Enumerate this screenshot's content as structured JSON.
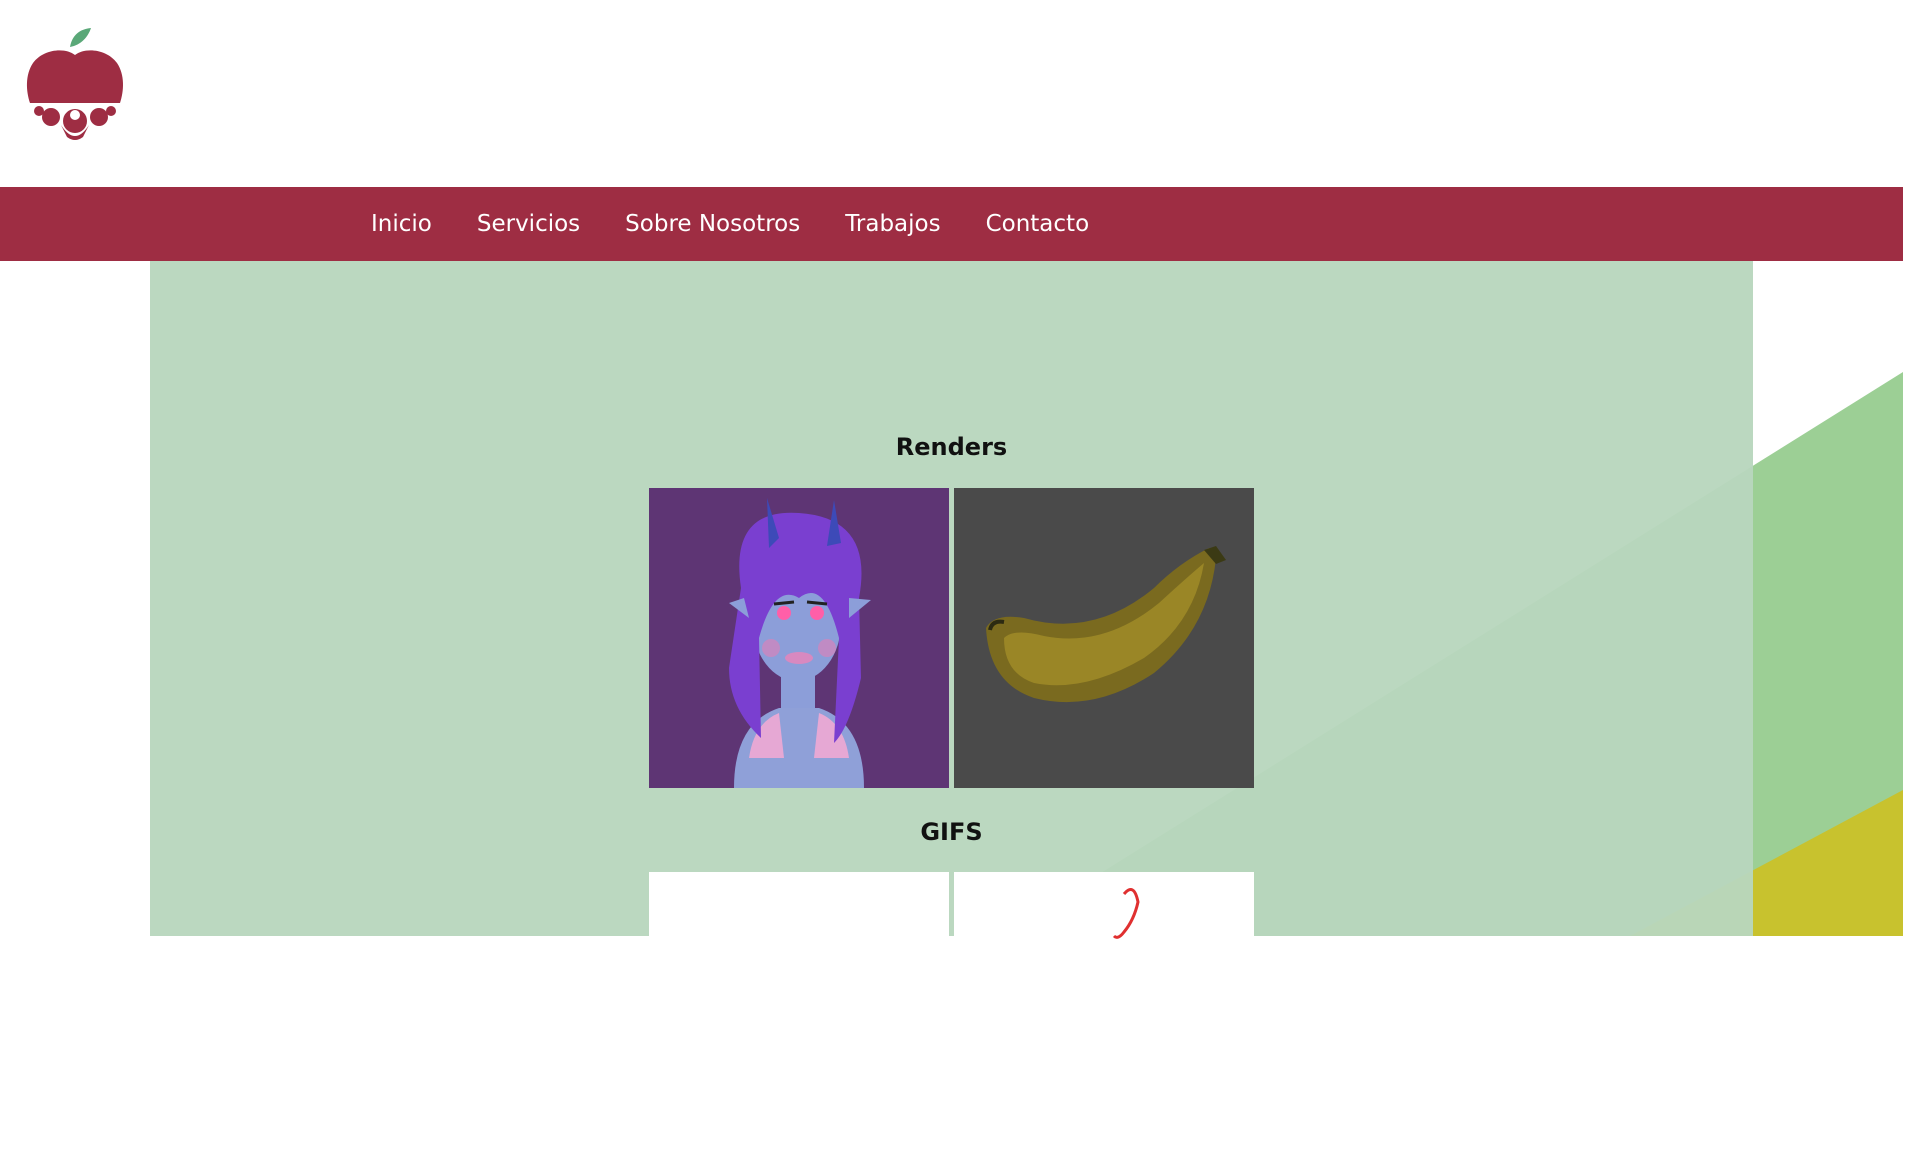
{
  "brand": {
    "logo_icon": "apple-people-logo-icon",
    "primary_color": "#9e2d43",
    "leaf_color": "#5aa878"
  },
  "nav": {
    "items": [
      {
        "label": "Inicio"
      },
      {
        "label": "Servicios"
      },
      {
        "label": "Sobre Nosotros"
      },
      {
        "label": "Trabajos"
      },
      {
        "label": "Contacto"
      }
    ]
  },
  "sections": {
    "renders": {
      "title": "Renders",
      "items": [
        {
          "icon": "demon-character-render-image",
          "bg": "#5e3574"
        },
        {
          "icon": "banana-render-image",
          "bg": "#4a4a4a"
        }
      ]
    },
    "gifs": {
      "title": "GIFS",
      "items": [
        {
          "icon": "blank-gif-image",
          "bg": "#ffffff"
        },
        {
          "icon": "red-sketch-gif-image",
          "bg": "#ffffff"
        }
      ]
    }
  },
  "colors": {
    "content_bg": "#b8d6bd",
    "diagonal_green": "#9ccf95",
    "diagonal_yellow": "#c8c22e"
  }
}
